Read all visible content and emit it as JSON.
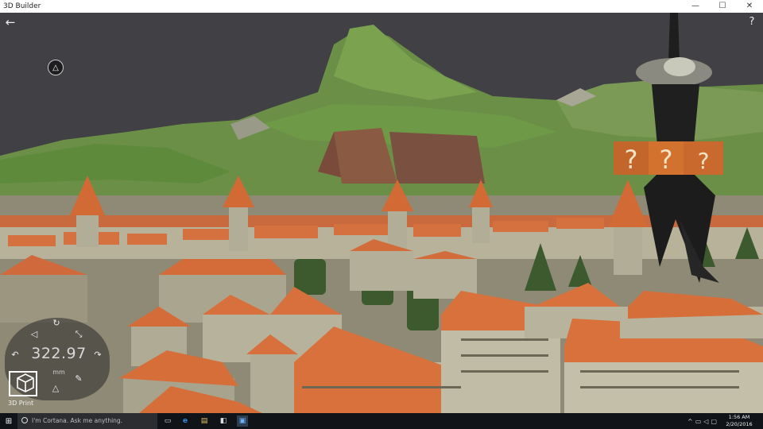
{
  "window": {
    "title": "3D Builder",
    "min_icon": "minimize-icon",
    "max_icon": "maximize-icon",
    "close_icon": "close-icon",
    "min_glyph": "—",
    "max_glyph": "☐",
    "close_glyph": "✕"
  },
  "overlay": {
    "back_icon": "back-arrow-icon",
    "back_glyph": "←",
    "help_glyph": "?",
    "nav_glyph": "△"
  },
  "gizmo": {
    "value": "322.97",
    "unit": "mm",
    "rotate_glyph": "↻",
    "scale_glyph": "⤡",
    "undo_glyph": "↶",
    "redo_glyph": "↷",
    "edit_glyph": "✎",
    "up_glyph": "△",
    "left_glyph": "◁",
    "right_glyph": "▷"
  },
  "print": {
    "label": "3D Print"
  },
  "taskbar": {
    "cortana_placeholder": "I'm Cortana. Ask me anything.",
    "time": "1:56 AM",
    "date": "2/20/2016",
    "start_glyph": "⊞"
  },
  "colors": {
    "sky": "#404045",
    "mountain": "#5f8a3f",
    "roof": "#d06838",
    "wall": "#a9a48e",
    "taskbar": "#101418"
  }
}
